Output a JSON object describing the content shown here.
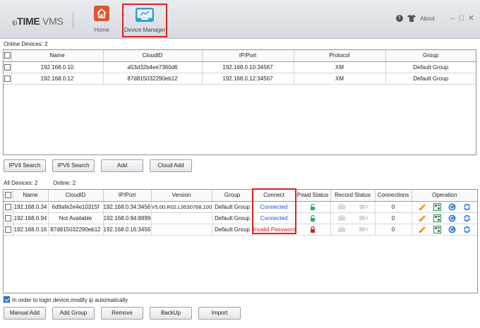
{
  "app": {
    "logo_ip": "ip",
    "logo_time": "TIME",
    "logo_vms": " VMS"
  },
  "nav": {
    "home_label": "Home",
    "device_manager_label": "Device Manager"
  },
  "titlebar": {
    "info_icon": "!",
    "about_label": "About",
    "minimize": "–",
    "maximize": "□",
    "close": "✕"
  },
  "online": {
    "section_label": "Online Devices:  2",
    "columns": [
      "",
      "Name",
      "CloudID",
      "IP/Port",
      "Protocol",
      "Group"
    ],
    "rows": [
      {
        "name": "192.168.0.10",
        "cloudid": "a53d32b4ee7360d6",
        "ipport": "192.168.0.10:34567",
        "protocol": "XM",
        "group": "Default Group"
      },
      {
        "name": "192.168.0.12",
        "cloudid": "87d815032290eb12",
        "ipport": "192.168.0.12:34567",
        "protocol": "XM",
        "group": "Default Group"
      }
    ]
  },
  "search_buttons": {
    "ipv4": "IPV4 Search",
    "ipv6": "IPV6 Search",
    "add": "Add",
    "cloud_add": "Cloud Add"
  },
  "all": {
    "all_devices_label": "All Devices:  2",
    "online_label": "Online:  2",
    "columns": [
      "",
      "Name",
      "CloudID",
      "IP/Port",
      "Version",
      "Group",
      "Connect",
      "Pswd Status",
      "Record Status",
      "Connections",
      "Operation"
    ],
    "rows": [
      {
        "name": "192.168.0.34",
        "cloudid": "6d9afe2e4e10315f",
        "ipport": "192.168.0.34:34567",
        "version": "V5.00.R02.L9530768.100",
        "group": "Default Group",
        "connect": "Connected",
        "connect_status": "ok",
        "pswd": "unlocked",
        "connections": "0"
      },
      {
        "name": "192.168.0.94",
        "cloudid": "Not Available",
        "ipport": "192.168.0.94:8899",
        "version": "",
        "group": "Default Group",
        "connect": "Connected",
        "connect_status": "ok",
        "pswd": "unlocked",
        "connections": "0"
      },
      {
        "name": "192.168.0.16",
        "cloudid": "87d815032290eb12",
        "ipport": "192.168.0.16:34567",
        "version": "",
        "group": "Default Group",
        "connect": "Invalid Password",
        "connect_status": "error",
        "pswd": "locked",
        "connections": "0"
      }
    ]
  },
  "auto_modify_ip": {
    "checked": true,
    "label": "In order to login device,modify ip automatically"
  },
  "bottom_buttons": {
    "manual_add": "Manual Add",
    "add_group": "Add Group",
    "remove": "Remove",
    "backup": "BackUp",
    "import": "Import"
  },
  "colors": {
    "connected": "#1c4fd8",
    "invalid": "#d51919",
    "highlight": "#e0201f"
  }
}
